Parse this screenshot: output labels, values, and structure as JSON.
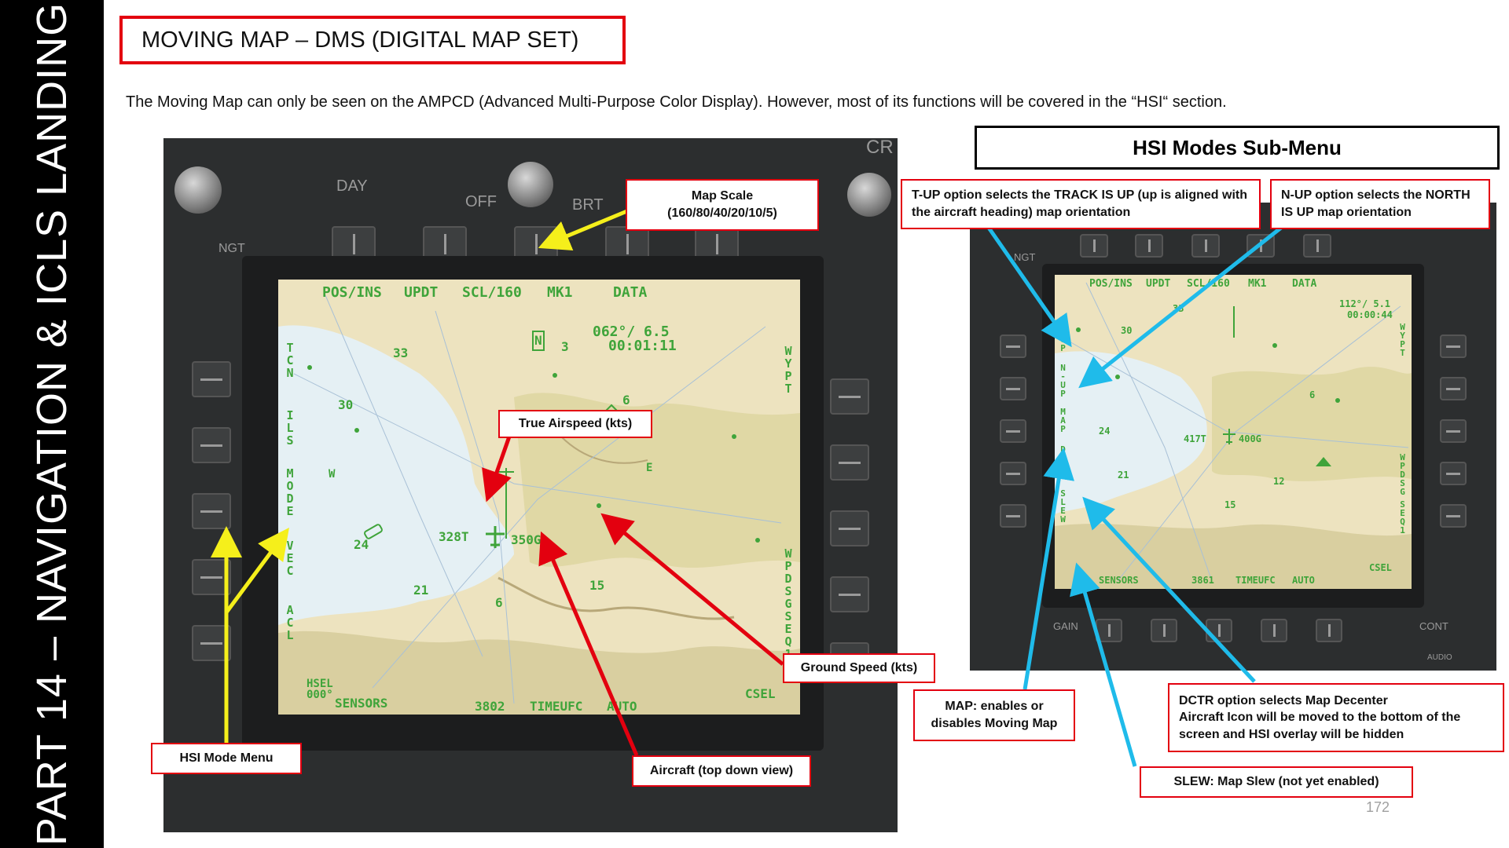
{
  "sidebar": {
    "text": "PART 14 – NAVIGATION & ICLS LANDING"
  },
  "title": "MOVING MAP – DMS (DIGITAL MAP SET)",
  "intro": "The Moving Map can only be seen on the AMPCD (Advanced Multi-Purpose Color Display). However, most of its functions will be covered in the “HSI“ section.",
  "left_display": {
    "panel_labels": {
      "day": "DAY",
      "off": "OFF",
      "brt": "BRT",
      "ngt": "NGT",
      "cr": "CR"
    },
    "top_row": [
      "POS/INS",
      "UPDT",
      "SCL/160",
      "MK1",
      "DATA"
    ],
    "left_column": [
      "TCN",
      "ILS",
      "MODE",
      "VEC",
      "ACL"
    ],
    "right_column": [
      "WYPT",
      "WPDSG",
      "SEQ1"
    ],
    "bottom_row": [
      "SENSORS",
      "3802",
      "TIMEUFC",
      "AUTO"
    ],
    "hsel": "HSEL\n000°",
    "csel": "CSEL",
    "readout": {
      "bearing_range": "062°/ 6.5",
      "time": "00:01:11"
    },
    "true_airspeed": "328T",
    "ground_speed": "350G",
    "map_numbers": [
      "33",
      "3",
      "30",
      "6",
      "W",
      "E",
      "24",
      "21",
      "15",
      "6"
    ],
    "north": "N"
  },
  "right_display": {
    "panel_labels": {
      "ngt": "NGT",
      "gain": "GAIN",
      "cont": "CONT",
      "audio": "AUDIO"
    },
    "top_row": [
      "POS/INS",
      "UPDT",
      "SCL/160",
      "MK1",
      "DATA"
    ],
    "left_column": [
      "T-UP",
      "N-UP",
      "MAP",
      "DCTR",
      "SLEW"
    ],
    "right_column": [
      "WYPT",
      "WPDSG",
      "SEQ1"
    ],
    "bottom_row": [
      "SENSORS",
      "3861",
      "TIMEUFC",
      "AUTO"
    ],
    "csel": "CSEL",
    "readout": {
      "bearing_range": "112°/ 5.1",
      "time": "00:00:44"
    },
    "true_airspeed": "417T",
    "ground_speed": "400G",
    "map_numbers": [
      "33",
      "30",
      "24",
      "21",
      "15",
      "12",
      "6"
    ]
  },
  "callouts": {
    "map_scale": "Map Scale\n(160/80/40/20/10/5)",
    "true_airspeed": "True Airspeed (kts)",
    "ground_speed": "Ground Speed (kts)",
    "hsi_mode_menu": "HSI Mode Menu",
    "aircraft": "Aircraft (top down view)",
    "t_up": "T-UP option selects the TRACK IS UP (up is aligned with the aircraft heading) map orientation",
    "n_up": "N-UP option selects the NORTH IS UP map orientation",
    "map": "MAP: enables or disables Moving Map",
    "dctr": "DCTR option selects Map Decenter\nAircraft Icon will be moved to the bottom of the screen and HSI overlay will be hidden",
    "slew": "SLEW: Map Slew (not yet enabled)"
  },
  "hsi_header": "HSI Modes Sub-Menu",
  "page_number": "172",
  "colors": {
    "callout_border": "#e3000f",
    "hud_green": "#3fa43a",
    "arrow_red": "#e3000f",
    "arrow_yellow": "#f5ef1b",
    "arrow_cyan": "#1fbbea"
  }
}
